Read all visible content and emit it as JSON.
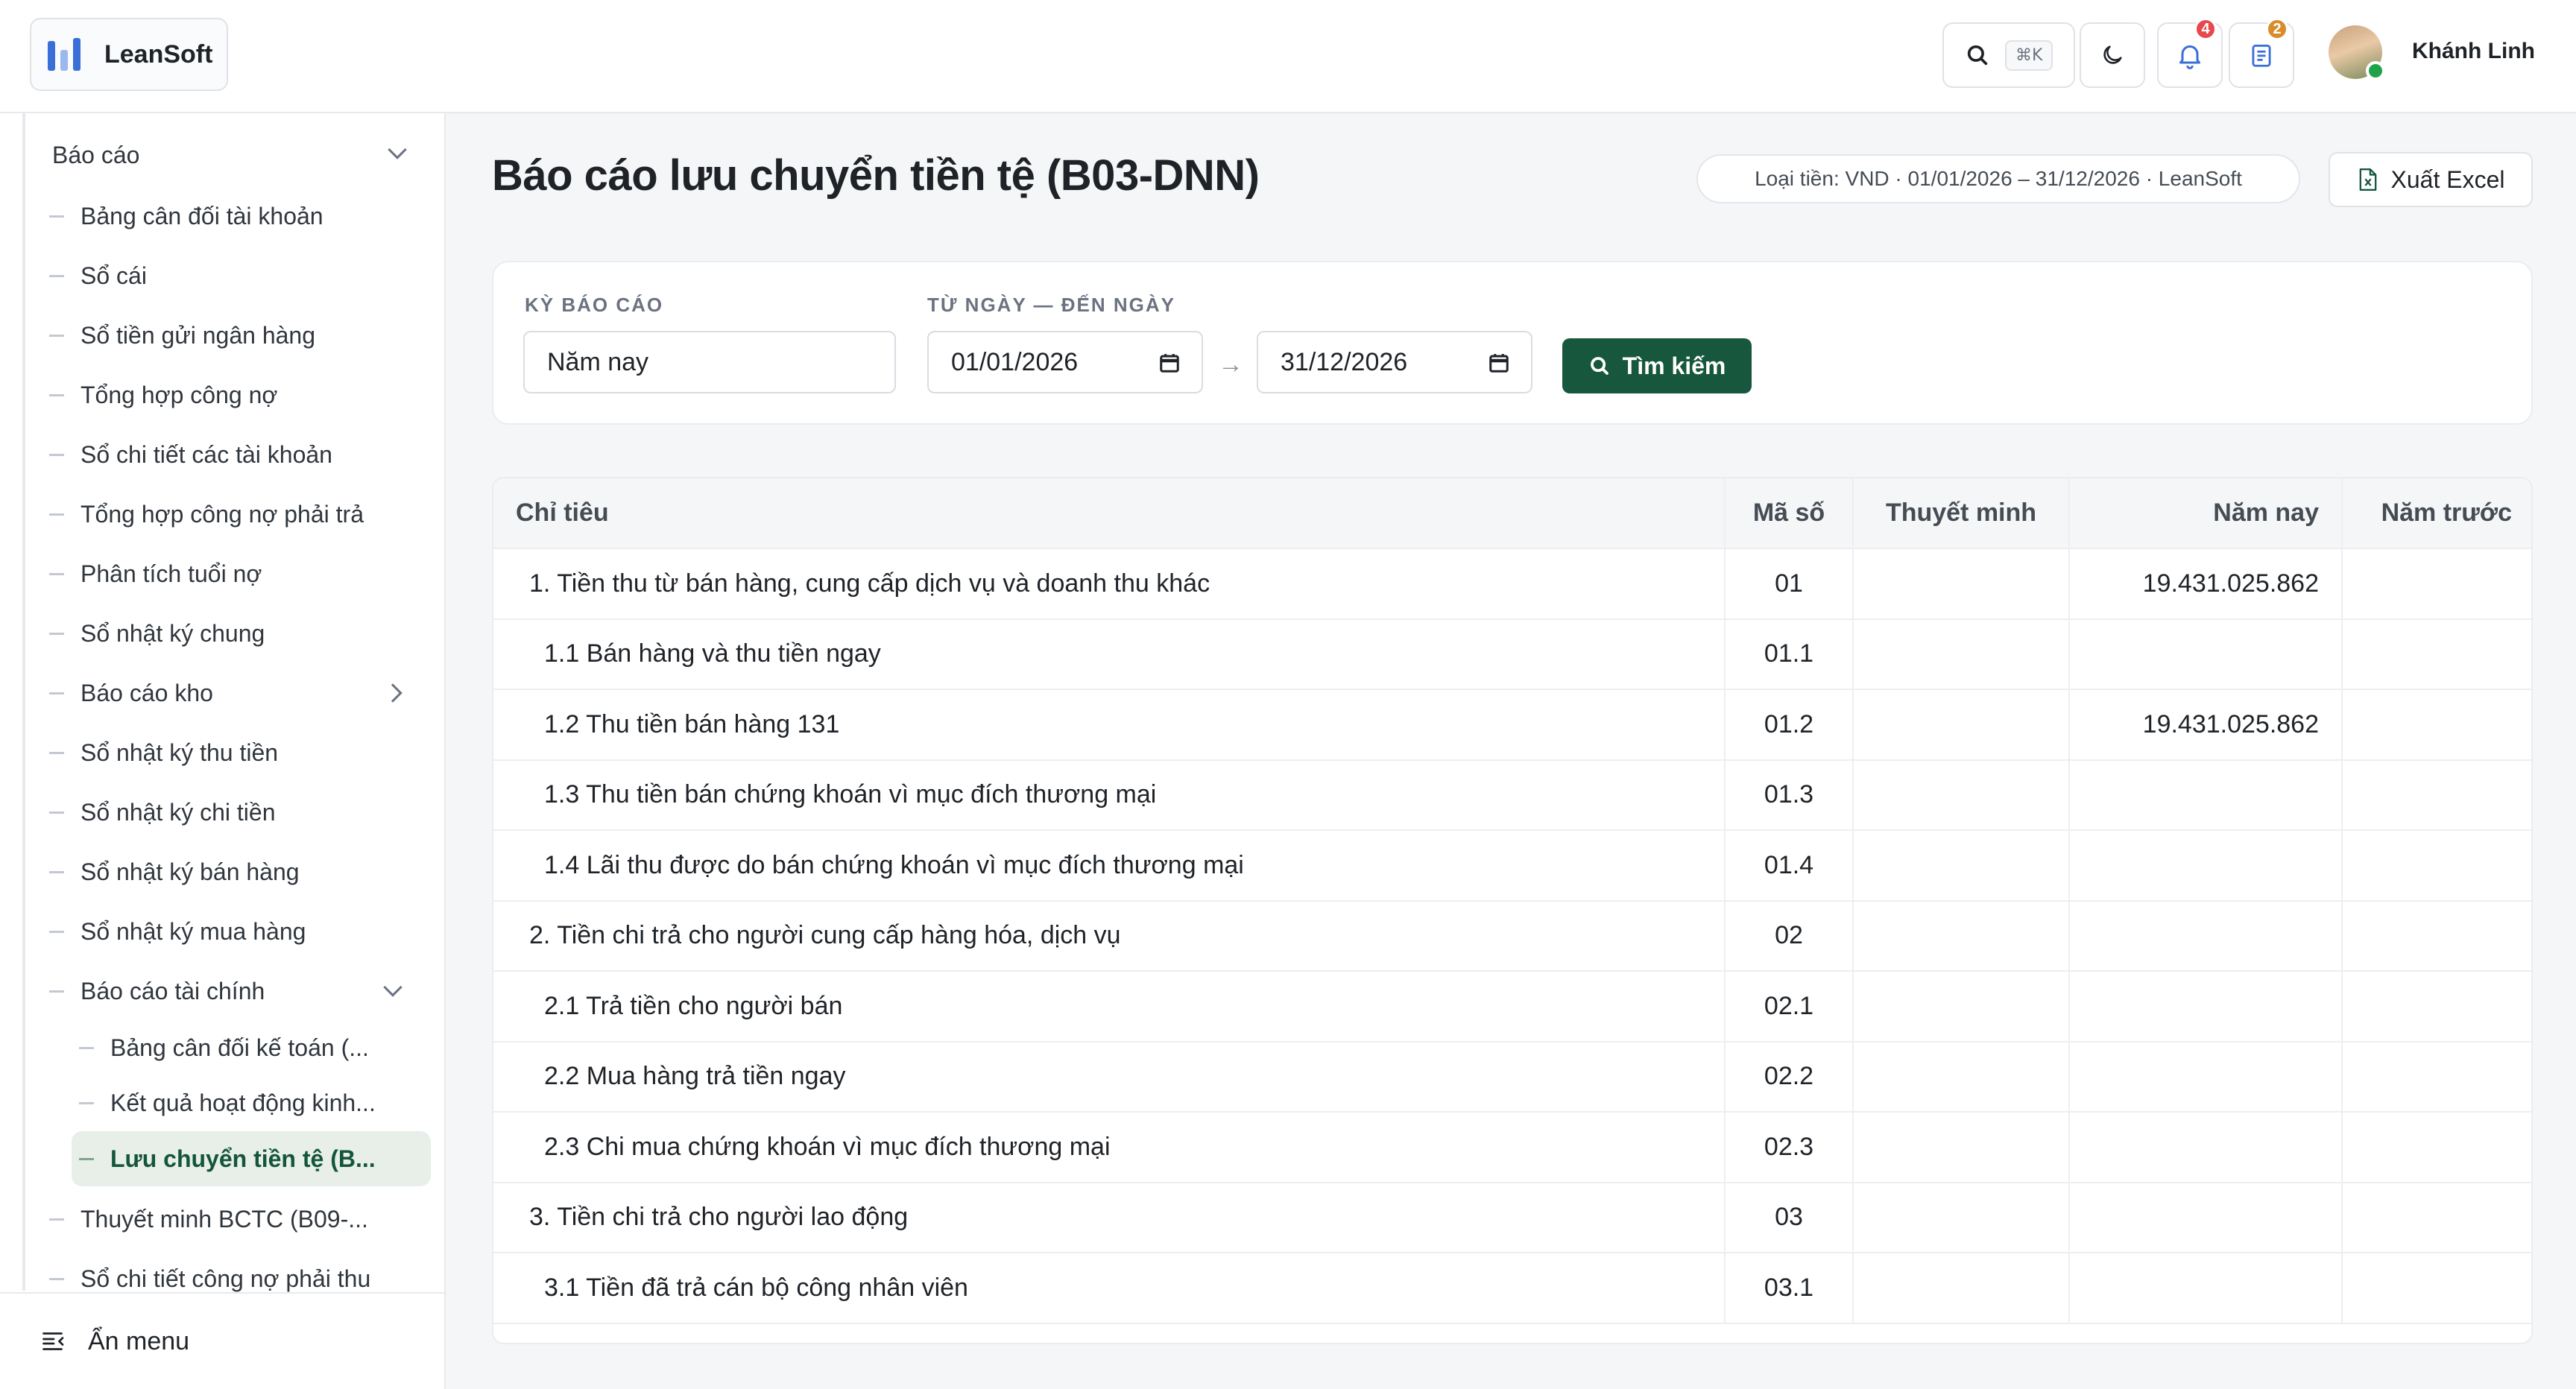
{
  "header": {
    "brand": "LeanSoft",
    "search_shortcut": "⌘K",
    "notifications_count": "4",
    "tasks_count": "2",
    "user_name": "Khánh Linh",
    "icons": [
      "search-icon",
      "moon-icon",
      "bell-icon",
      "clipboard-icon"
    ]
  },
  "sidebar": {
    "group": "Báo cáo",
    "items": [
      {
        "label": "Bảng cân đối tài khoản"
      },
      {
        "label": "Sổ cái"
      },
      {
        "label": "Sổ tiền gửi ngân hàng"
      },
      {
        "label": "Tổng hợp công nợ"
      },
      {
        "label": "Sổ chi tiết các tài khoản"
      },
      {
        "label": "Tổng hợp công nợ phải trả"
      },
      {
        "label": "Phân tích tuổi nợ"
      },
      {
        "label": "Sổ nhật ký chung"
      },
      {
        "label": "Báo cáo kho"
      },
      {
        "label": "Sổ nhật ký thu tiền"
      },
      {
        "label": "Sổ nhật ký chi tiền"
      },
      {
        "label": "Sổ nhật ký bán hàng"
      },
      {
        "label": "Sổ nhật ký mua hàng"
      },
      {
        "label": "Báo cáo tài chính"
      },
      {
        "label": "Bảng cân đối kế toán (..."
      },
      {
        "label": "Kết quả hoạt động kinh..."
      },
      {
        "label": "Lưu chuyển tiền tệ (B..."
      },
      {
        "label": "Thuyết minh BCTC (B09-..."
      },
      {
        "label": "Sổ chi tiết công nợ phải thu"
      }
    ],
    "hide_menu": "Ẩn menu"
  },
  "page": {
    "title": "Báo cáo lưu chuyển tiền tệ (B03-DNN)",
    "meta": "Loại tiền: VND · 01/01/2026 – 31/12/2026 · LeanSoft",
    "export_label": "Xuất Excel"
  },
  "filters": {
    "period_label": "KỲ BÁO CÁO",
    "period_value": "Năm nay",
    "range_label": "TỪ NGÀY — ĐẾN NGÀY",
    "from_date": "01/01/2026",
    "to_date": "31/12/2026",
    "arrow": "→",
    "search_label": "Tìm kiếm"
  },
  "table": {
    "headers": {
      "label": "Chỉ tiêu",
      "code": "Mã số",
      "note": "Thuyết minh",
      "current": "Năm nay",
      "previous": "Năm trước"
    },
    "rows": [
      {
        "label": "1. Tiền thu từ bán hàng, cung cấp dịch vụ và doanh thu khác",
        "code": "01",
        "note": "",
        "current": "19.431.025.862",
        "previous": ""
      },
      {
        "label": "1.1 Bán hàng và thu tiền ngay",
        "code": "01.1",
        "note": "",
        "current": "",
        "previous": ""
      },
      {
        "label": "1.2 Thu tiền bán hàng 131",
        "code": "01.2",
        "note": "",
        "current": "19.431.025.862",
        "previous": ""
      },
      {
        "label": "1.3 Thu tiền bán chứng khoán vì mục đích thương mại",
        "code": "01.3",
        "note": "",
        "current": "",
        "previous": ""
      },
      {
        "label": "1.4 Lãi thu được do bán chứng khoán vì mục đích thương mại",
        "code": "01.4",
        "note": "",
        "current": "",
        "previous": ""
      },
      {
        "label": "2. Tiền chi trả cho người cung cấp hàng hóa, dịch vụ",
        "code": "02",
        "note": "",
        "current": "",
        "previous": ""
      },
      {
        "label": "2.1 Trả tiền cho người bán",
        "code": "02.1",
        "note": "",
        "current": "",
        "previous": ""
      },
      {
        "label": "2.2 Mua hàng trả tiền ngay",
        "code": "02.2",
        "note": "",
        "current": "",
        "previous": ""
      },
      {
        "label": "2.3 Chi mua chứng khoán vì mục đích thương mại",
        "code": "02.3",
        "note": "",
        "current": "",
        "previous": ""
      },
      {
        "label": "3. Tiền chi trả cho người lao động",
        "code": "03",
        "note": "",
        "current": "",
        "previous": ""
      },
      {
        "label": "3.1 Tiền đã trả cán bộ công nhân viên",
        "code": "03.1",
        "note": "",
        "current": "",
        "previous": ""
      }
    ]
  }
}
